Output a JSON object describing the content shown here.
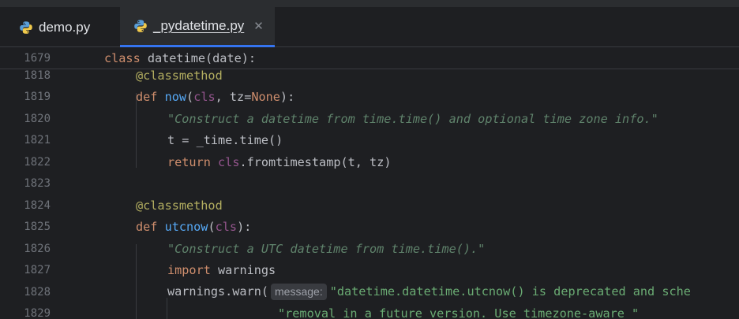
{
  "tabs": [
    {
      "label": "demo.py",
      "active": false,
      "icon": "python-file-icon"
    },
    {
      "label": "_pydatetime.py",
      "active": true,
      "icon": "python-file-icon",
      "close": "✕"
    }
  ],
  "editor": {
    "sticky_line": {
      "number": "1679",
      "kw": "class",
      "rest": " datetime(date):"
    },
    "lines": [
      {
        "number": "1818",
        "deco": "@classmethod"
      },
      {
        "number": "1819",
        "kw": "def",
        "fn": "now",
        "p1": "(",
        "self": "cls",
        "p2": ", tz=",
        "kw2": "None",
        "p3": "):"
      },
      {
        "number": "1820",
        "doc": "\"Construct a datetime from time.time() and optional time zone info.\""
      },
      {
        "number": "1821",
        "text": "t = _time.time()"
      },
      {
        "number": "1822",
        "kw": "return",
        "self": "cls",
        "rest": ".fromtimestamp(t, tz)"
      },
      {
        "number": "1823"
      },
      {
        "number": "1824",
        "deco": "@classmethod"
      },
      {
        "number": "1825",
        "kw": "def",
        "fn": "utcnow",
        "p1": "(",
        "self": "cls",
        "p2": "):"
      },
      {
        "number": "1826",
        "doc": "\"Construct a UTC datetime from time.time().\""
      },
      {
        "number": "1827",
        "kw": "import",
        "rest": " warnings"
      },
      {
        "number": "1828",
        "pre": "warnings.warn(",
        "hint": "message:",
        "str": "\"datetime.datetime.utcnow() is deprecated and sche"
      },
      {
        "number": "1829",
        "str": "\"removal in a future version. Use timezone-aware \""
      }
    ]
  },
  "colors": {
    "background": "#1e1f22",
    "keyword": "#cf8e6d",
    "function": "#56a8f5",
    "self_param": "#94558d",
    "string": "#6aab73",
    "docstring": "#5f826b",
    "decorator": "#b3ae60",
    "tab_active_underline": "#3574f0"
  }
}
